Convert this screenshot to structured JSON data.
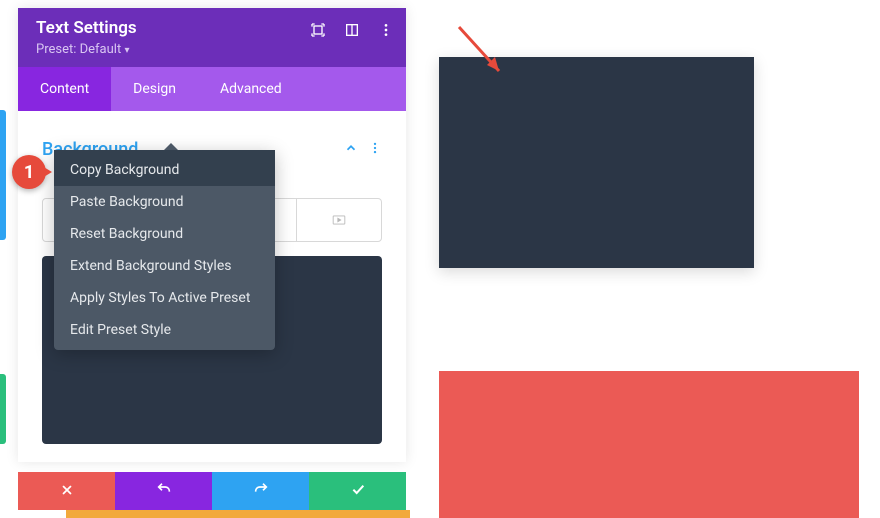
{
  "panel": {
    "title": "Text Settings",
    "preset_label": "Preset: Default",
    "tabs": {
      "content": "Content",
      "design": "Design",
      "advanced": "Advanced"
    },
    "section": {
      "title": "Background"
    }
  },
  "context_menu": {
    "items": [
      "Copy Background",
      "Paste Background",
      "Reset Background",
      "Extend Background Styles",
      "Apply Styles To Active Preset",
      "Edit Preset Style"
    ]
  },
  "step_badge": "1",
  "colors": {
    "purple_dark": "#6c2eb9",
    "purple": "#8826e0",
    "purple_light": "#a459ec",
    "blue": "#2ea3f2",
    "green": "#2abf7c",
    "red": "#eb5a55",
    "dark": "#2b3646"
  }
}
